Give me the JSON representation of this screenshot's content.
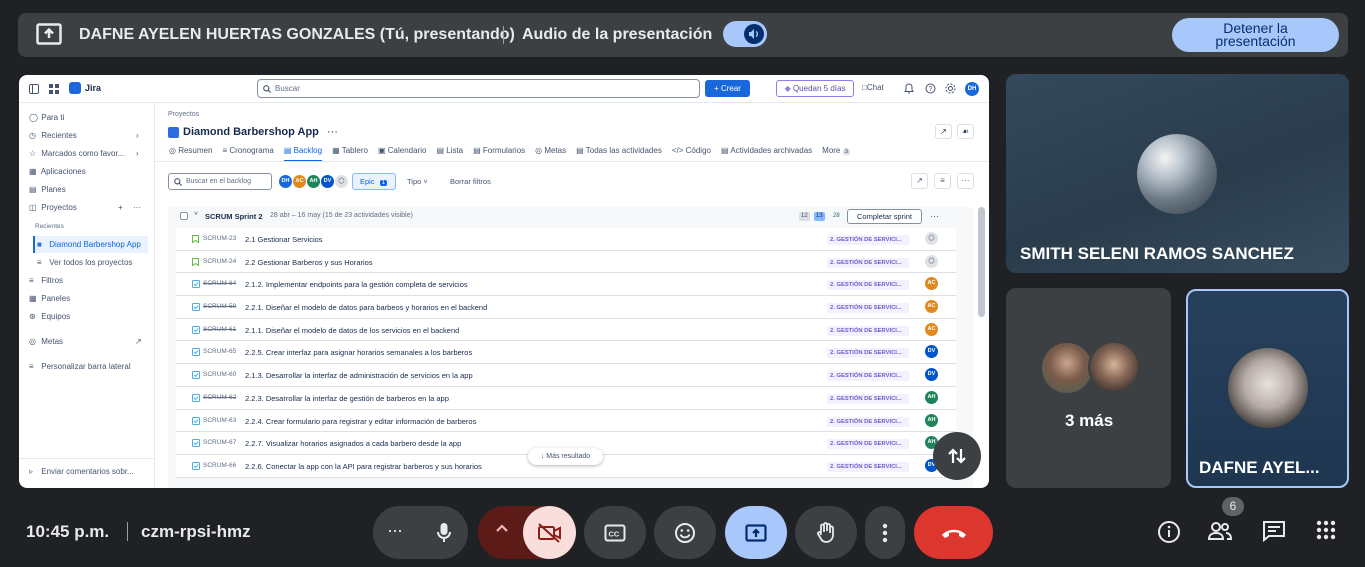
{
  "topbar": {
    "presenter": "DAFNE AYELEN HUERTAS GONZALES (Tú, presentando)",
    "audio_label": "Audio de la presentación",
    "stop_button": "Detener la\npresentación"
  },
  "jira": {
    "logo": "Jira",
    "search_placeholder": "Buscar",
    "create": "+ Crear",
    "trial": "Quedan 5 días",
    "chat": "Chat",
    "user_initials": "DH",
    "sidebar": {
      "items": [
        "Para ti",
        "Recientes",
        "Marcados como favor...",
        "Aplicaciones",
        "Planes",
        "Proyectos"
      ],
      "recent_label": "Recientes",
      "active_project": "Diamond Barbershop App",
      "view_all": "Ver todos los proyectos",
      "items2": [
        "Filtros",
        "Paneles",
        "Equipos"
      ],
      "metas": "Metas",
      "customize": "Personalizar barra lateral",
      "feedback": "Enviar comentarios sobr..."
    },
    "breadcrumb": "Proyectos",
    "project_title": "Diamond Barbershop App",
    "tabs": [
      "Resumen",
      "Cronograma",
      "Backlog",
      "Tablero",
      "Calendario",
      "Lista",
      "Formularios",
      "Metas",
      "Todas las actividades",
      "Código",
      "Actividades archivadas",
      "More"
    ],
    "more_count": "3",
    "backlog_search": "Buscar en el backlog",
    "filter_avatars": [
      "DH",
      "AC",
      "AH",
      "DV"
    ],
    "epic_filter": "Epic",
    "epic_count": "1",
    "tipo": "Tipo",
    "borrar": "Borrar filtros",
    "sprint": {
      "name": "SCRUM Sprint 2",
      "dates": "28 abr – 16 may (15 de 23 actividades visible)",
      "counts": [
        "12",
        "13",
        "28"
      ],
      "complete": "Completar sprint"
    },
    "rows": [
      {
        "key": "SCRUM-23",
        "summary": "2.1 Gestionar Servicios",
        "epic": "2. GESTIÓN DE SERVICI...",
        "assignee": "",
        "type": "story",
        "done": false
      },
      {
        "key": "SCRUM-24",
        "summary": "2.2 Gestionar Barberos y sus Horarios",
        "epic": "2. GESTIÓN DE SERVICI...",
        "assignee": "",
        "type": "story",
        "done": false
      },
      {
        "key": "SCRUM-64",
        "summary": "2.1.2. Implementar endpoints para la gestión completa de servicios",
        "epic": "2. GESTIÓN DE SERVICI...",
        "assignee": "AC",
        "type": "task",
        "done": true
      },
      {
        "key": "SCRUM-59",
        "summary": "2.2.1. Diseñar el modelo de datos para barbeos y horarios en el backend",
        "epic": "2. GESTIÓN DE SERVICI...",
        "assignee": "AC",
        "type": "task",
        "done": true
      },
      {
        "key": "SCRUM-61",
        "summary": "2.1.1. Diseñar el modelo de datos de los servicios en el backend",
        "epic": "2. GESTIÓN DE SERVICI...",
        "assignee": "AC",
        "type": "task",
        "done": true
      },
      {
        "key": "SCRUM-65",
        "summary": "2.2.5. Crear interfaz para asignar horarios semanales a los barberos",
        "epic": "2. GESTIÓN DE SERVICI...",
        "assignee": "DV",
        "type": "task",
        "done": false
      },
      {
        "key": "SCRUM-60",
        "summary": "2.1.3. Desarrollar la interfaz de administración de servicios en la app",
        "epic": "2. GESTIÓN DE SERVICI...",
        "assignee": "DV",
        "type": "task",
        "done": false
      },
      {
        "key": "SCRUM-62",
        "summary": "2.2.3. Desarrollar la interfaz de gestión de barberos en la app",
        "epic": "2. GESTIÓN DE SERVICI...",
        "assignee": "AH",
        "type": "task",
        "done": true
      },
      {
        "key": "SCRUM-63",
        "summary": "2.2.4. Crear formulario para registrar y editar información de barberos",
        "epic": "2. GESTIÓN DE SERVICI...",
        "assignee": "AH",
        "type": "task",
        "done": false
      },
      {
        "key": "SCRUM-67",
        "summary": "2.2.7. Visualizar horarios asignados a cada barbero desde la app",
        "epic": "2. GESTIÓN DE SERVICI...",
        "assignee": "AH",
        "type": "task",
        "done": false
      },
      {
        "key": "SCRUM-66",
        "summary": "2.2.6. Conectar la app con la API para registrar barberos y sus horarios",
        "epic": "2. GESTIÓN DE SERVICI...",
        "assignee": "DV",
        "type": "task",
        "done": false
      }
    ],
    "more_results": "Más resultado",
    "avatar_colors": {
      "DH": "#1868db",
      "AC": "#e2891d",
      "AH": "#1f845a",
      "DV": "#0055cc"
    }
  },
  "participants": [
    {
      "name": "SMITH SELENI RAMOS SANCHEZ"
    },
    {
      "name": "3 más"
    },
    {
      "name": "DAFNE AYEL..."
    }
  ],
  "bottom": {
    "time": "10:45 p.m.",
    "meeting_code": "czm-rpsi-hmz",
    "people_count": "6"
  }
}
